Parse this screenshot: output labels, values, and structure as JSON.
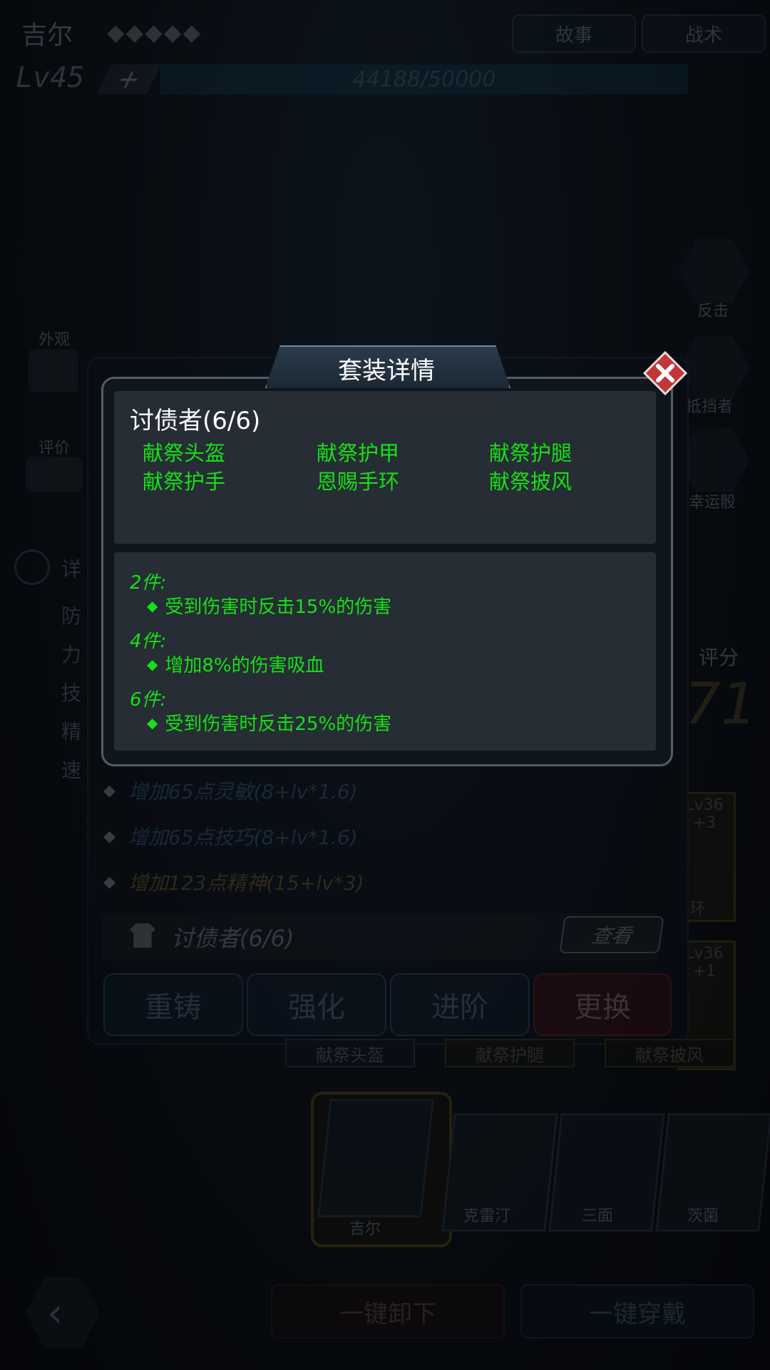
{
  "header": {
    "hero_name": "吉尔",
    "stars": "◆◆◆◆◆",
    "story_label": "故事",
    "tactics_label": "战术",
    "level": "Lv45",
    "level_up": "+",
    "exp_text": "44188/50000"
  },
  "left_side": {
    "appearance": "外观",
    "review": "评价",
    "details": "详",
    "stats": [
      "防",
      "力",
      "技",
      "精",
      "速"
    ]
  },
  "right_side": {
    "skills": [
      "反击",
      "抵挡者",
      "幸运骰"
    ],
    "score_label": "评分",
    "score_value": "71",
    "card_levels": [
      "Lv36 +3",
      "Lv36 +1"
    ],
    "card_names": [
      "环"
    ]
  },
  "equipment": {
    "attributes": [
      {
        "text": "增加65点灵敏(8+lv*1.6)",
        "tone": "blue"
      },
      {
        "text": "增加65点技巧(8+lv*1.6)",
        "tone": "blue"
      },
      {
        "text": "增加123点精神(15+lv*3)",
        "tone": "gold"
      }
    ],
    "set_row_label": "讨债者(6/6)",
    "view_label": "查看",
    "actions": [
      "重铸",
      "强化",
      "进阶",
      "更换"
    ],
    "slot_labels": [
      "献祭头盔",
      "献祭护腿",
      "献祭披风"
    ]
  },
  "roster": {
    "names": [
      "吉尔",
      "克雷汀",
      "三面",
      "茨菌"
    ]
  },
  "bottom": {
    "unequip_all": "一键卸下",
    "equip_all": "一键穿戴"
  },
  "modal": {
    "title": "套装详情",
    "set_name": "讨债者(6/6)",
    "pieces": [
      "献祭头盔",
      "献祭护甲",
      "献祭护腿",
      "献祭护手",
      "恩赐手环",
      "献祭披风"
    ],
    "bonuses": [
      {
        "head": "2件:",
        "effect": "受到伤害时反击15%的伤害"
      },
      {
        "head": "4件:",
        "effect": "增加8%的伤害吸血"
      },
      {
        "head": "6件:",
        "effect": "受到伤害时反击25%的伤害"
      }
    ]
  },
  "colors": {
    "green_text": "#16e016",
    "modal_bg": "#262d34",
    "close_red": "#c0373a"
  }
}
